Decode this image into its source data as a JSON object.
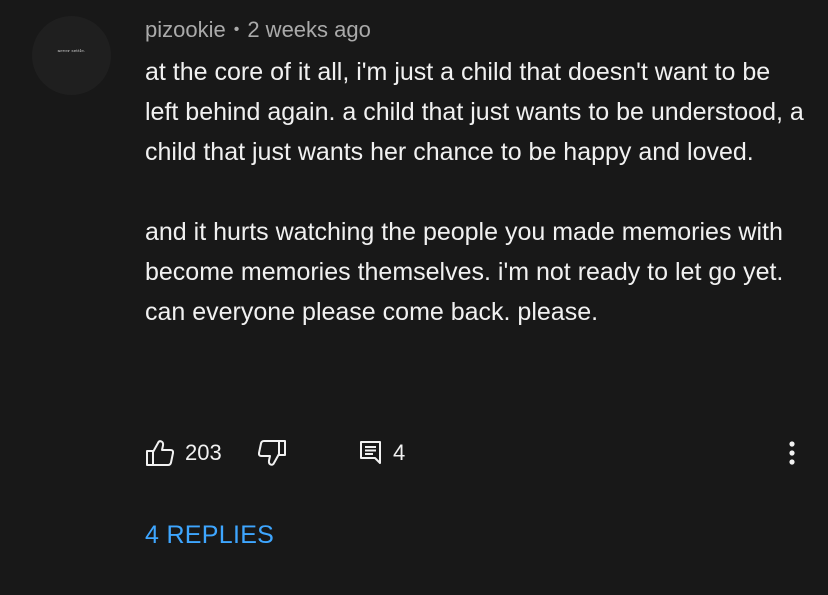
{
  "comment": {
    "avatar_text": "never settle.",
    "author": "pizookie",
    "separator": "•",
    "timestamp": "2 weeks ago",
    "paragraphs": [
      "at the core of it all, i'm just a child that doesn't want to be left behind again. a child that just wants to be understood, a child that just wants her chance to be happy and loved.",
      "and it hurts watching the people you made memories with become memories themselves. i'm not ready to let go yet. can everyone please come back. please."
    ],
    "actions": {
      "like_count": "203",
      "reply_count": "4",
      "like_icon": "thumbs-up-icon",
      "dislike_icon": "thumbs-down-icon",
      "reply_icon": "comment-icon",
      "more_icon": "more-vertical-icon"
    },
    "replies_link": "4 REPLIES"
  },
  "colors": {
    "background": "#181818",
    "text": "#f1f1f1",
    "meta": "#aaaaaa",
    "link": "#3ea6ff"
  }
}
